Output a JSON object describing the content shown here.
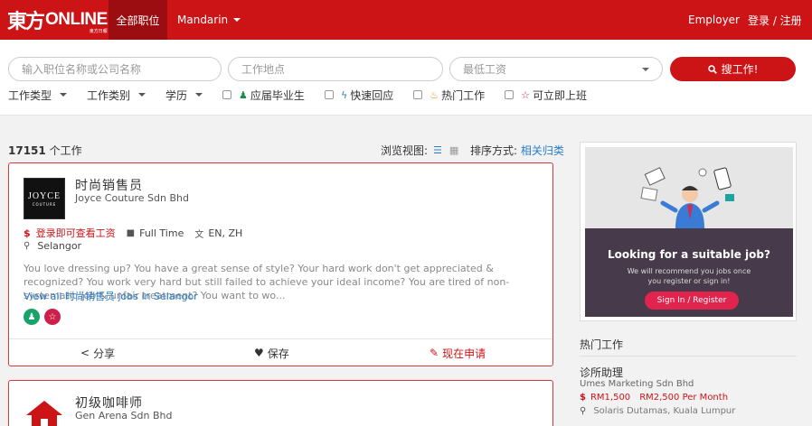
{
  "colors": {
    "brand_red": "#cc1417",
    "link_blue": "#2a7ec8",
    "promo_bg": "#473a4a",
    "promo_button": "#e0244d"
  },
  "nav": {
    "logo_mark": "東方",
    "logo_word": "ONLINE",
    "logo_sub": "東方日報",
    "active_tab": "全部职位",
    "language": "Mandarin",
    "employer": "Employer",
    "login": "登录 / 注册"
  },
  "search": {
    "keyword_placeholder": "输入职位名称或公司名称",
    "location_placeholder": "工作地点",
    "salary_placeholder": "最低工资",
    "button_label": "搜工作!",
    "button_icon": "search-icon"
  },
  "filters": {
    "dropdowns": [
      "工作类型",
      "工作类别",
      "学历"
    ],
    "checkboxes": [
      {
        "label": "应届毕业生",
        "icon": "graduate-icon",
        "checked": false
      },
      {
        "label": "快速回应",
        "icon": "lightning-icon",
        "checked": false
      },
      {
        "label": "热门工作",
        "icon": "fire-icon",
        "checked": false
      },
      {
        "label": "可立即上班",
        "icon": "star-icon",
        "checked": false
      }
    ]
  },
  "results": {
    "count": "17151",
    "count_suffix": " 个工作",
    "view_label": "浏览视图:",
    "sort_label": "排序方式:",
    "sort_value": "相关归类"
  },
  "jobs": [
    {
      "logo_text": "JOYCE",
      "logo_sub": "COUTURE",
      "title": "时尚销售员",
      "company": "Joyce Couture Sdn Bhd",
      "salary": "登录即可查看工资",
      "type": "Full Time",
      "languages": "EN, ZH",
      "location": "Selangor",
      "description": "You love dressing up? You have a great sense of style? Your hard work don't get appreciated & recognized? You work very hard but still failed to achieve your ideal income? You are tired of non-systematic job & unfair treatment? You want to wo...",
      "view_all": "View all 时尚销售员 jobs in Selangor",
      "share": "分享",
      "save": "保存",
      "apply": "现在申请"
    },
    {
      "title": "初级咖啡师",
      "company": "Gen Arena Sdn Bhd"
    }
  ],
  "promo": {
    "heading": "Looking for a suitable job?",
    "subtext_line1": "We will recommend you jobs once",
    "subtext_line2": "you register or sign in!",
    "button": "Sign In / Register"
  },
  "hot_jobs": {
    "title": "热门工作",
    "items": [
      {
        "title": "诊所助理",
        "company": "Umes Marketing Sdn Bhd",
        "salary_min": "RM1,500",
        "salary_max": "RM2,500 Per Month",
        "location": "Solaris Dutamas, Kuala Lumpur"
      }
    ]
  }
}
